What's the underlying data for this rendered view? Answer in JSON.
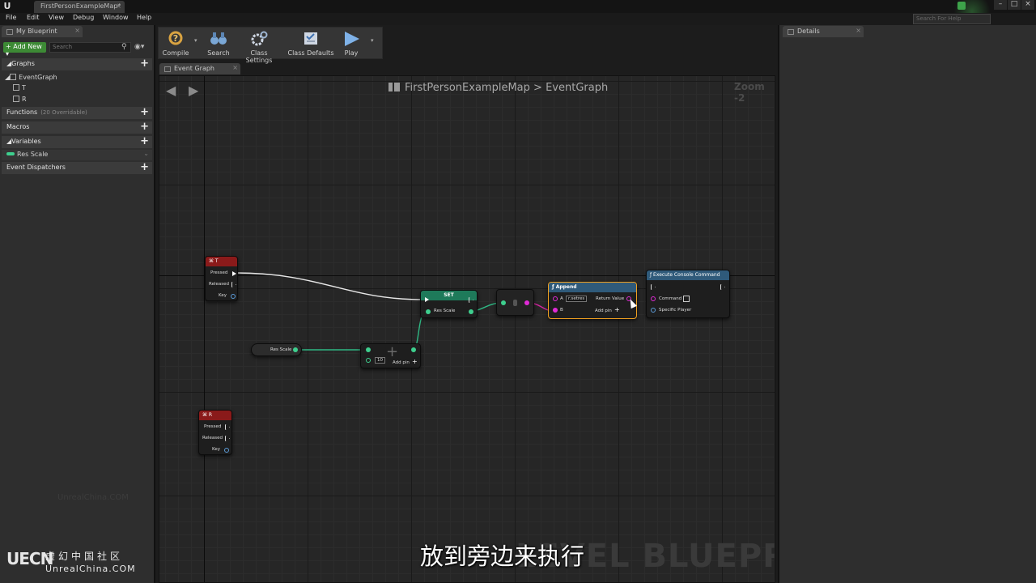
{
  "titlebar": {
    "doc_tab": "FirstPersonExampleMap*",
    "help_placeholder": "Search For Help"
  },
  "menu": [
    "File",
    "Edit",
    "View",
    "Debug",
    "Window",
    "Help"
  ],
  "my_blueprint": {
    "tab_label": "My Blueprint",
    "add_new_label": "Add New",
    "search_placeholder": "Search",
    "sections": {
      "graphs": "Graphs",
      "functions": "Functions",
      "functions_sub": "(20 Overridable)",
      "macros": "Macros",
      "variables": "Variables",
      "dispatchers": "Event Dispatchers"
    },
    "graph_items": [
      "EventGraph",
      "T",
      "R"
    ],
    "variables": [
      "Res Scale"
    ]
  },
  "toolbar": {
    "compile": "Compile",
    "search": "Search",
    "class_settings": "Class Settings",
    "class_defaults": "Class Defaults",
    "play": "Play"
  },
  "graph": {
    "tab_label": "Event Graph",
    "breadcrumb_root": "FirstPersonExampleMap",
    "breadcrumb_sep": ">",
    "breadcrumb_leaf": "EventGraph",
    "zoom": "Zoom -2",
    "watermark": "LEVEL BLUEPRINT",
    "site_watermark": "UnrealChina.COM"
  },
  "nodes": {
    "t_event": {
      "title": "T",
      "pressed": "Pressed",
      "released": "Released",
      "key": "Key"
    },
    "r_event": {
      "title": "R",
      "pressed": "Pressed",
      "released": "Released",
      "key": "Key"
    },
    "set_node": {
      "title": "SET",
      "var": "Res Scale"
    },
    "get_var": {
      "label": "Res Scale"
    },
    "add_node": {
      "b_value": "10",
      "add_pin": "Add pin"
    },
    "append": {
      "title": "Append",
      "a": "A",
      "a_value": "r.setres",
      "b": "B",
      "return": "Return Value",
      "add_pin": "Add pin"
    },
    "console": {
      "title": "Execute Console Command",
      "command": "Command",
      "player": "Specific Player"
    }
  },
  "details": {
    "tab_label": "Details"
  },
  "overlay": {
    "subtitle": "放到旁边来执行",
    "logo_mark": "UECN",
    "logo_cn": "虚幻中国社区",
    "logo_en": "UnrealChina.COM"
  },
  "colors": {
    "exec": "#ffffff",
    "float_pin": "#3ecf8e",
    "string_pin": "#e02bd6",
    "event_header": "#8a1a1a",
    "set_header": "#1e7a5a",
    "function_header": "#2f5a7a",
    "selection": "#f0a020"
  }
}
